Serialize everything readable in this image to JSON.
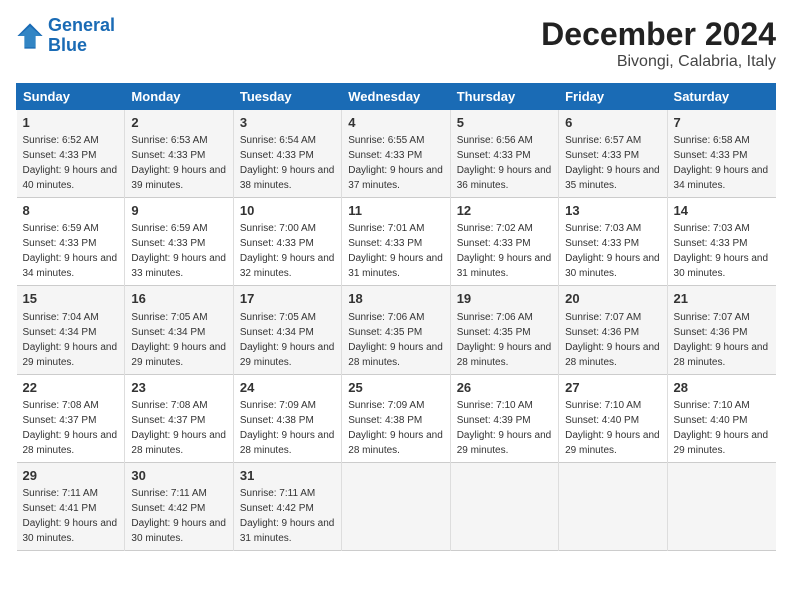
{
  "logo": {
    "line1": "General",
    "line2": "Blue"
  },
  "title": "December 2024",
  "subtitle": "Bivongi, Calabria, Italy",
  "days_of_week": [
    "Sunday",
    "Monday",
    "Tuesday",
    "Wednesday",
    "Thursday",
    "Friday",
    "Saturday"
  ],
  "weeks": [
    [
      {
        "day": "1",
        "sunrise": "6:52 AM",
        "sunset": "4:33 PM",
        "daylight": "9 hours and 40 minutes."
      },
      {
        "day": "2",
        "sunrise": "6:53 AM",
        "sunset": "4:33 PM",
        "daylight": "9 hours and 39 minutes."
      },
      {
        "day": "3",
        "sunrise": "6:54 AM",
        "sunset": "4:33 PM",
        "daylight": "9 hours and 38 minutes."
      },
      {
        "day": "4",
        "sunrise": "6:55 AM",
        "sunset": "4:33 PM",
        "daylight": "9 hours and 37 minutes."
      },
      {
        "day": "5",
        "sunrise": "6:56 AM",
        "sunset": "4:33 PM",
        "daylight": "9 hours and 36 minutes."
      },
      {
        "day": "6",
        "sunrise": "6:57 AM",
        "sunset": "4:33 PM",
        "daylight": "9 hours and 35 minutes."
      },
      {
        "day": "7",
        "sunrise": "6:58 AM",
        "sunset": "4:33 PM",
        "daylight": "9 hours and 34 minutes."
      }
    ],
    [
      {
        "day": "8",
        "sunrise": "6:59 AM",
        "sunset": "4:33 PM",
        "daylight": "9 hours and 34 minutes."
      },
      {
        "day": "9",
        "sunrise": "6:59 AM",
        "sunset": "4:33 PM",
        "daylight": "9 hours and 33 minutes."
      },
      {
        "day": "10",
        "sunrise": "7:00 AM",
        "sunset": "4:33 PM",
        "daylight": "9 hours and 32 minutes."
      },
      {
        "day": "11",
        "sunrise": "7:01 AM",
        "sunset": "4:33 PM",
        "daylight": "9 hours and 31 minutes."
      },
      {
        "day": "12",
        "sunrise": "7:02 AM",
        "sunset": "4:33 PM",
        "daylight": "9 hours and 31 minutes."
      },
      {
        "day": "13",
        "sunrise": "7:03 AM",
        "sunset": "4:33 PM",
        "daylight": "9 hours and 30 minutes."
      },
      {
        "day": "14",
        "sunrise": "7:03 AM",
        "sunset": "4:33 PM",
        "daylight": "9 hours and 30 minutes."
      }
    ],
    [
      {
        "day": "15",
        "sunrise": "7:04 AM",
        "sunset": "4:34 PM",
        "daylight": "9 hours and 29 minutes."
      },
      {
        "day": "16",
        "sunrise": "7:05 AM",
        "sunset": "4:34 PM",
        "daylight": "9 hours and 29 minutes."
      },
      {
        "day": "17",
        "sunrise": "7:05 AM",
        "sunset": "4:34 PM",
        "daylight": "9 hours and 29 minutes."
      },
      {
        "day": "18",
        "sunrise": "7:06 AM",
        "sunset": "4:35 PM",
        "daylight": "9 hours and 28 minutes."
      },
      {
        "day": "19",
        "sunrise": "7:06 AM",
        "sunset": "4:35 PM",
        "daylight": "9 hours and 28 minutes."
      },
      {
        "day": "20",
        "sunrise": "7:07 AM",
        "sunset": "4:36 PM",
        "daylight": "9 hours and 28 minutes."
      },
      {
        "day": "21",
        "sunrise": "7:07 AM",
        "sunset": "4:36 PM",
        "daylight": "9 hours and 28 minutes."
      }
    ],
    [
      {
        "day": "22",
        "sunrise": "7:08 AM",
        "sunset": "4:37 PM",
        "daylight": "9 hours and 28 minutes."
      },
      {
        "day": "23",
        "sunrise": "7:08 AM",
        "sunset": "4:37 PM",
        "daylight": "9 hours and 28 minutes."
      },
      {
        "day": "24",
        "sunrise": "7:09 AM",
        "sunset": "4:38 PM",
        "daylight": "9 hours and 28 minutes."
      },
      {
        "day": "25",
        "sunrise": "7:09 AM",
        "sunset": "4:38 PM",
        "daylight": "9 hours and 28 minutes."
      },
      {
        "day": "26",
        "sunrise": "7:10 AM",
        "sunset": "4:39 PM",
        "daylight": "9 hours and 29 minutes."
      },
      {
        "day": "27",
        "sunrise": "7:10 AM",
        "sunset": "4:40 PM",
        "daylight": "9 hours and 29 minutes."
      },
      {
        "day": "28",
        "sunrise": "7:10 AM",
        "sunset": "4:40 PM",
        "daylight": "9 hours and 29 minutes."
      }
    ],
    [
      {
        "day": "29",
        "sunrise": "7:11 AM",
        "sunset": "4:41 PM",
        "daylight": "9 hours and 30 minutes."
      },
      {
        "day": "30",
        "sunrise": "7:11 AM",
        "sunset": "4:42 PM",
        "daylight": "9 hours and 30 minutes."
      },
      {
        "day": "31",
        "sunrise": "7:11 AM",
        "sunset": "4:42 PM",
        "daylight": "9 hours and 31 minutes."
      },
      {
        "day": "",
        "sunrise": "",
        "sunset": "",
        "daylight": ""
      },
      {
        "day": "",
        "sunrise": "",
        "sunset": "",
        "daylight": ""
      },
      {
        "day": "",
        "sunrise": "",
        "sunset": "",
        "daylight": ""
      },
      {
        "day": "",
        "sunrise": "",
        "sunset": "",
        "daylight": ""
      }
    ]
  ],
  "labels": {
    "sunrise": "Sunrise: ",
    "sunset": "Sunset: ",
    "daylight": "Daylight: "
  }
}
